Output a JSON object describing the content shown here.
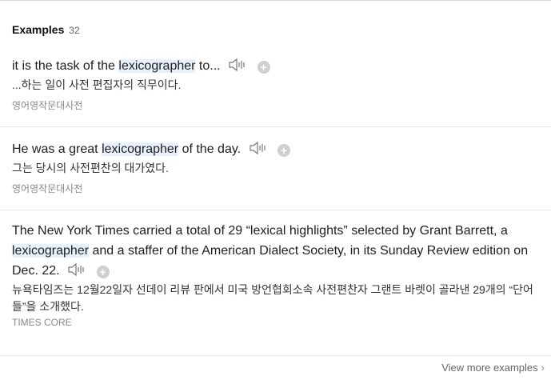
{
  "header": {
    "title": "Examples",
    "count": "32"
  },
  "examples": [
    {
      "en_before": "it is the task of the ",
      "en_highlight": "lexicographer",
      "en_after": " to...",
      "ko": "...하는 일이 사전 편집자의 직무이다.",
      "source": "영어영작문대사전"
    },
    {
      "en_before": "He was a great ",
      "en_highlight": "lexicographer",
      "en_after": " of the day.",
      "ko": "그는 당시의 사전편찬의 대가였다.",
      "source": "영어영작문대사전"
    },
    {
      "en_before": "The New York Times carried a total of 29 “lexical highlights” selected by Grant Barrett, a ",
      "en_highlight": "lexicographer",
      "en_after": " and a staffer of the American Dialect Society, in its Sunday Review edition on Dec. 22.",
      "ko": "뉴욕타임즈는 12월22일자 선데이 리뷰 판에서 미국 방언협회소속 사전편찬자 그랜트 바렛이 골라낸 29개의 “단어들”을 소개했다.",
      "source": "TIMES CORE"
    }
  ],
  "icons": {
    "speaker": "speaker-icon",
    "add": "add-circle-icon",
    "chevron": "chevron-right-icon"
  },
  "add_glyph": "+",
  "footer": {
    "view_more": "View more examples",
    "chevron": "›"
  },
  "colors": {
    "highlight": "#e8f1fb",
    "add_icon": "#cfcfcf"
  }
}
